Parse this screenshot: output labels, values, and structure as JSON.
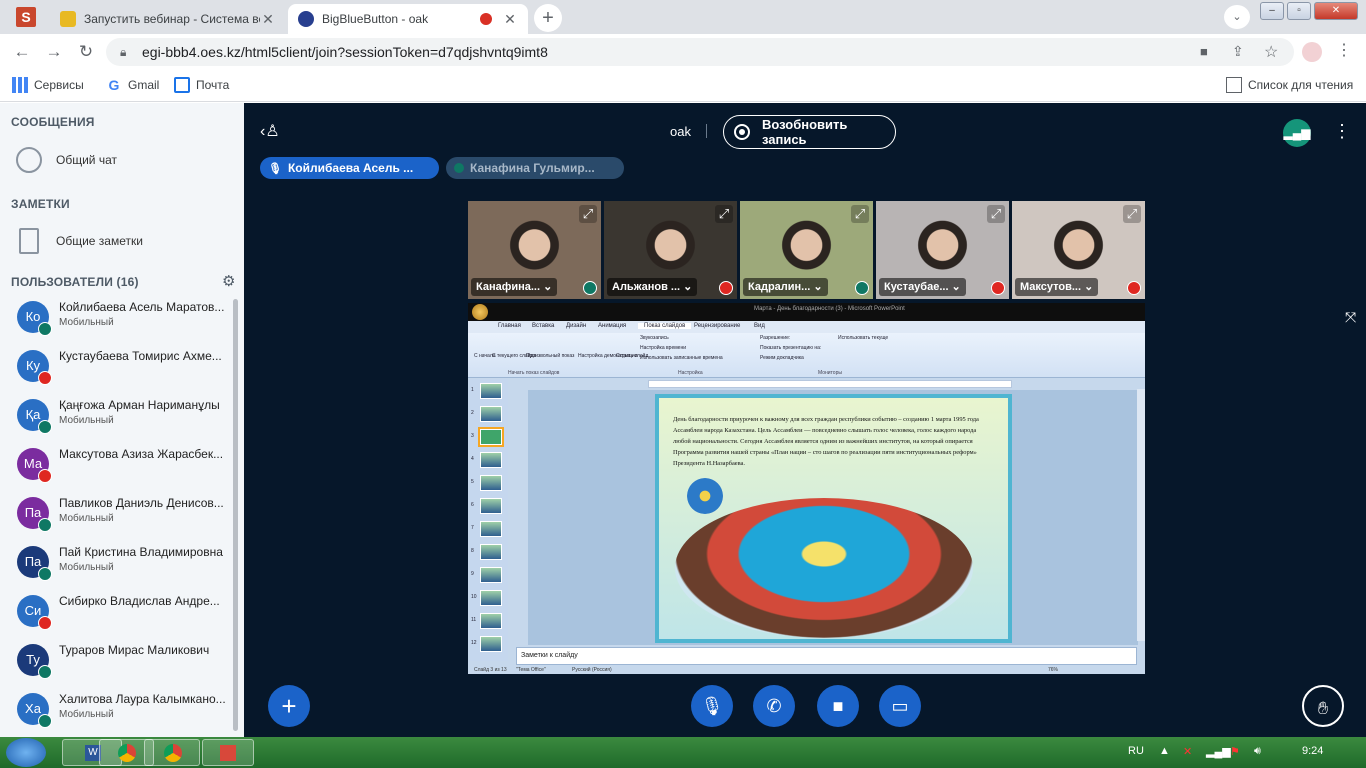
{
  "browser": {
    "tabs": [
      {
        "title": "Запустить вебинар - Система ве",
        "active": false
      },
      {
        "title": "BigBlueButton - oak",
        "active": true
      }
    ],
    "url": "egi-bbb4.oes.kz/html5client/join?sessionToken=d7qdjshvntq9imt8",
    "bookmarks": [
      "Сервисы",
      "Gmail",
      "Почта"
    ],
    "reading_list": "Список для чтения"
  },
  "sidebar": {
    "messages_header": "СООБЩЕНИЯ",
    "public_chat": "Общий чат",
    "notes_header": "ЗАМЕТКИ",
    "shared_notes": "Общие заметки",
    "users_header": "ПОЛЬЗОВАТЕЛИ (16)",
    "users": [
      {
        "initials": "Ко",
        "name": "Койлибаева Асель Маратов...",
        "sub": "Мобильный",
        "color": "#2a6fc4",
        "badge": "listen"
      },
      {
        "initials": "Ку",
        "name": "Кустаубаева Томирис Ахме...",
        "sub": "",
        "color": "#2a6fc4",
        "badge": "muted"
      },
      {
        "initials": "Қа",
        "name": "Қаңғожа Арман Нариманұлы",
        "sub": "Мобильный",
        "color": "#2a6fc4",
        "badge": "listen"
      },
      {
        "initials": "Ма",
        "name": "Максутова Азиза Жарасбек...",
        "sub": "",
        "color": "#7b2c9f",
        "badge": "muted"
      },
      {
        "initials": "Па",
        "name": "Павликов Даниэль Денисов...",
        "sub": "Мобильный",
        "color": "#7b2c9f",
        "badge": "listen"
      },
      {
        "initials": "Па",
        "name": "Пай Кристина Владимировна",
        "sub": "Мобильный",
        "color": "#1b3a7a",
        "badge": "listen"
      },
      {
        "initials": "Си",
        "name": "Сибирко Владислав Андре...",
        "sub": "",
        "color": "#2a6fc4",
        "badge": "muted"
      },
      {
        "initials": "Ту",
        "name": "Тураров Мирас Маликович",
        "sub": "",
        "color": "#1b3a7a",
        "badge": "listen"
      },
      {
        "initials": "Ха",
        "name": "Халитова Лаура Калымкано...",
        "sub": "Мобильный",
        "color": "#2a6fc4",
        "badge": "listen"
      }
    ]
  },
  "meeting": {
    "title": "oak",
    "record_label": "Возобновить запись",
    "talkers": [
      "Койлибаева Асель ...",
      "Канафина Гульмир..."
    ],
    "videos": [
      {
        "name": "Канафина...",
        "bg": "#7d6a5a",
        "muted": false
      },
      {
        "name": "Альжанов ...",
        "bg": "#3a3630",
        "muted": true
      },
      {
        "name": "Кадралин...",
        "bg": "#9da97a",
        "muted": false
      },
      {
        "name": "Кустаубае...",
        "bg": "#b8b4b4",
        "muted": true
      },
      {
        "name": "Максутов...",
        "bg": "#cfc6c0",
        "muted": true
      }
    ]
  },
  "screenshare": {
    "window_title": "Мартa - День благодарности (3) - Microsoft PowerPoint",
    "ribbon_tabs": [
      "Главная",
      "Вставка",
      "Дизайн",
      "Анимация",
      "Показ слайдов",
      "Рецензирование",
      "Вид"
    ],
    "ribbon_groups": [
      "Начать показ слайдов",
      "Настройка",
      "Мониторы"
    ],
    "ribbon_buttons": [
      "С начала",
      "С текущего слайда",
      "Произвольный показ",
      "Настройка демонстрации",
      "Скрыть слайд",
      "Звукозапись",
      "Настройка времени",
      "Использовать записанные времена",
      "Разрешение:",
      "Использовать текуще",
      "Показать презентацию на:",
      "Режим докладчика"
    ],
    "slide_text": "День благодарности приурочен к важному для всех граждан республики событию – созданию 1 марта 1995 года Ассамблеи народа Казахстана. Цель Ассамблеи — повседневно слышать голос человека, голос каждого народа любой национальности. Сегодня Ассамблея является одним из важнейших институтов, на который опирается Программа развития нашей страны «План нации – сто шагов по реализации пяти институциональных реформ» Президента Н.Назарбаева.",
    "notes_placeholder": "Заметки к слайду",
    "status": [
      "Слайд 3 из 13",
      "\"Тема Office\"",
      "Русский (Россия)"
    ],
    "zoom": "76%",
    "slide_numbers": [
      "1",
      "2",
      "3",
      "4",
      "5",
      "6",
      "7",
      "8",
      "9",
      "10",
      "11",
      "12"
    ]
  },
  "taskbar": {
    "lang": "RU",
    "time": "9:24"
  }
}
